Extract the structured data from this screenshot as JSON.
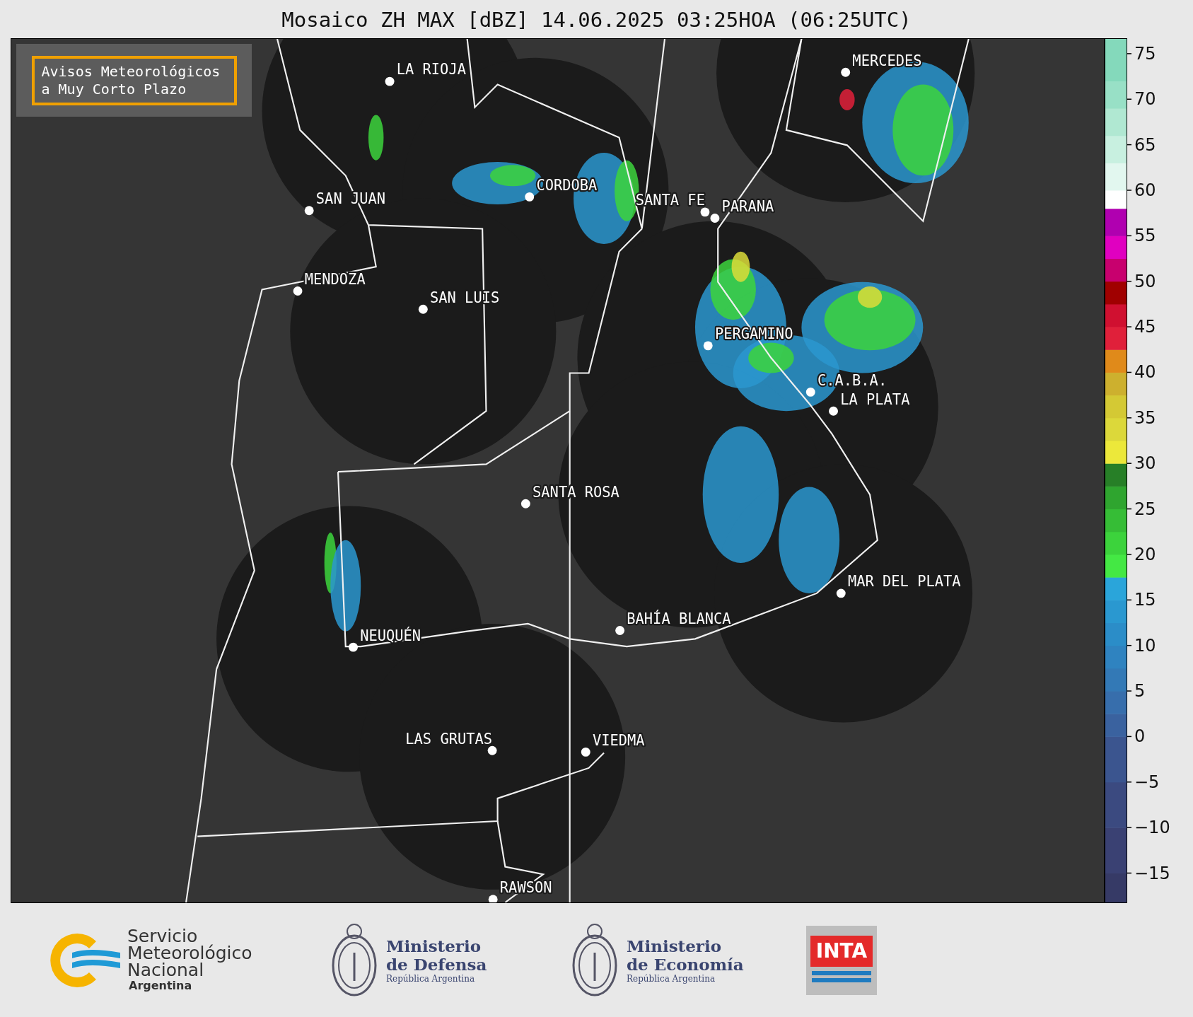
{
  "title": "Mosaico ZH MAX [dBZ] 14.06.2025 03:25HOA (06:25UTC)",
  "warning_box": {
    "lines": [
      "Avisos Meteorológicos",
      "a Muy Corto Plazo"
    ]
  },
  "cities": [
    {
      "name": "LA RIOJA"
    },
    {
      "name": "SAN JUAN"
    },
    {
      "name": "CORDOBA"
    },
    {
      "name": "SANTA FE"
    },
    {
      "name": "PARANA"
    },
    {
      "name": "MENDOZA"
    },
    {
      "name": "SAN LUIS"
    },
    {
      "name": "MERCEDES"
    },
    {
      "name": "PERGAMINO"
    },
    {
      "name": "C.A.B.A."
    },
    {
      "name": "LA PLATA"
    },
    {
      "name": "SANTA ROSA"
    },
    {
      "name": "NEUQUÉN"
    },
    {
      "name": "BAHÍA BLANCA"
    },
    {
      "name": "MAR DEL PLATA"
    },
    {
      "name": "LAS GRUTAS"
    },
    {
      "name": "VIEDMA"
    },
    {
      "name": "RAWSON"
    }
  ],
  "colorbar": {
    "ticks": [
      "75",
      "70",
      "65",
      "60",
      "55",
      "50",
      "45",
      "40",
      "35",
      "30",
      "25",
      "20",
      "15",
      "10",
      "5",
      "0",
      "−5",
      "−10",
      "−15"
    ]
  },
  "footer": {
    "smn": {
      "lines": [
        "Servicio",
        "Meteorológico",
        "Nacional"
      ],
      "country": "Argentina"
    },
    "ministries": [
      {
        "lines": [
          "Ministerio",
          "de Defensa"
        ],
        "country": "República Argentina"
      },
      {
        "lines": [
          "Ministerio",
          "de Economía"
        ],
        "country": "República Argentina"
      }
    ],
    "inta": "INTA"
  }
}
